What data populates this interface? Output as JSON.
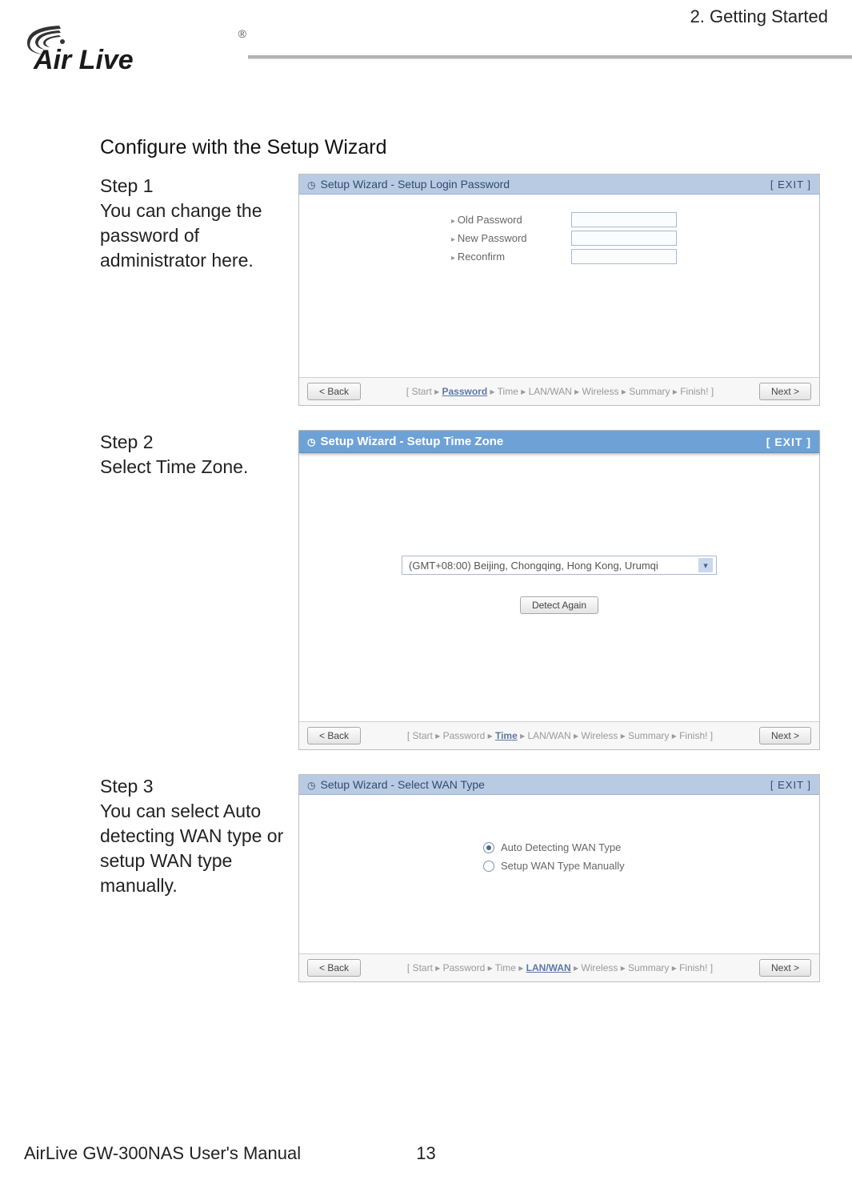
{
  "chapter": "2. Getting Started",
  "logo": {
    "brand_top": "Air",
    "brand_bottom": "Live",
    "reg": "®"
  },
  "section_title": "Configure with the Setup Wizard",
  "steps": {
    "step1": {
      "label": "Step 1",
      "desc": "You can change the password of administrator here.",
      "window_title": "Setup Wizard - Setup Login Password",
      "exit": "[ EXIT ]",
      "fields": {
        "old": "Old Password",
        "new": "New Password",
        "reconfirm": "Reconfirm"
      },
      "back": "< Back",
      "next": "Next >",
      "crumbs": "[ Start ▸ ",
      "crumbs_active": "Password",
      "crumbs_tail": " ▸ Time ▸ LAN/WAN ▸ Wireless ▸ Summary ▸ Finish! ]"
    },
    "step2": {
      "label": "Step 2",
      "desc": "Select Time Zone.",
      "window_title": "Setup Wizard - Setup Time Zone",
      "exit": "[ EXIT ]",
      "timezone": "(GMT+08:00) Beijing, Chongqing, Hong Kong, Urumqi",
      "detect": "Detect Again",
      "back": "< Back",
      "next": "Next >",
      "crumbs": "[ Start ▸ Password ▸ ",
      "crumbs_active": "Time",
      "crumbs_tail": " ▸ LAN/WAN ▸ Wireless ▸ Summary ▸ Finish! ]"
    },
    "step3": {
      "label": "Step 3",
      "desc": "You can select Auto detecting WAN type or setup WAN type manually.",
      "window_title": "Setup Wizard - Select WAN Type",
      "exit": "[ EXIT ]",
      "opt1": "Auto Detecting WAN Type",
      "opt2": "Setup WAN Type Manually",
      "back": "< Back",
      "next": "Next >",
      "crumbs": "[ Start ▸ Password ▸ Time ▸ ",
      "crumbs_active": "LAN/WAN",
      "crumbs_tail": " ▸ Wireless ▸ Summary ▸ Finish! ]"
    }
  },
  "footer": {
    "manual": "AirLive GW-300NAS User's Manual",
    "page": "13"
  }
}
